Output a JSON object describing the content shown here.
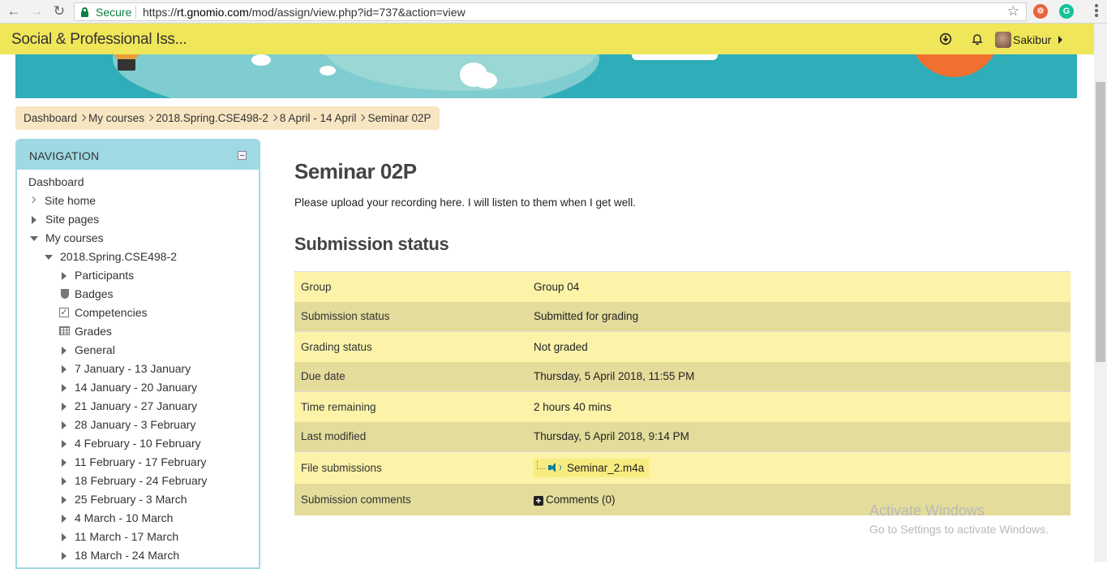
{
  "browser": {
    "secure_label": "Secure",
    "url_scheme": "https://",
    "url_host": "rt.gnomio.com",
    "url_path": "/mod/assign/view.php?id=737&action=view"
  },
  "header": {
    "site_title": "Social & Professional Iss...",
    "user_name": "Sakibur"
  },
  "breadcrumb": [
    "Dashboard",
    "My courses",
    "2018.Spring.CSE498-2",
    "8 April - 14 April",
    "Seminar 02P"
  ],
  "navigation": {
    "title": "NAVIGATION",
    "items": [
      {
        "label": "Dashboard"
      },
      {
        "label": "Site home"
      },
      {
        "label": "Site pages"
      },
      {
        "label": "My courses"
      },
      {
        "label": "2018.Spring.CSE498-2"
      },
      {
        "label": "Participants"
      },
      {
        "label": "Badges"
      },
      {
        "label": "Competencies"
      },
      {
        "label": "Grades"
      },
      {
        "label": "General"
      },
      {
        "label": "7 January - 13 January"
      },
      {
        "label": "14 January - 20 January"
      },
      {
        "label": "21 January - 27 January"
      },
      {
        "label": "28 January - 3 February"
      },
      {
        "label": "4 February - 10 February"
      },
      {
        "label": "11 February - 17 February"
      },
      {
        "label": "18 February - 24 February"
      },
      {
        "label": "25 February - 3 March"
      },
      {
        "label": "4 March - 10 March"
      },
      {
        "label": "11 March - 17 March"
      },
      {
        "label": "18 March - 24 March"
      }
    ]
  },
  "main": {
    "title": "Seminar 02P",
    "intro": "Please upload your recording here. I will listen to them when I get well.",
    "status_heading": "Submission status",
    "rows": [
      {
        "label": "Group",
        "value": "Group 04"
      },
      {
        "label": "Submission status",
        "value": "Submitted for grading"
      },
      {
        "label": "Grading status",
        "value": "Not graded"
      },
      {
        "label": "Due date",
        "value": "Thursday, 5 April 2018, 11:55 PM"
      },
      {
        "label": "Time remaining",
        "value": "2 hours 40 mins"
      },
      {
        "label": "Last modified",
        "value": "Thursday, 5 April 2018, 9:14 PM"
      },
      {
        "label": "File submissions",
        "value": "Seminar_2.m4a"
      },
      {
        "label": "Submission comments",
        "value": "Comments (0)"
      }
    ]
  },
  "watermark": {
    "line1": "Activate Windows",
    "line2": "Go to Settings to activate Windows."
  },
  "colors": {
    "topbar": "#f0e659",
    "nav_header": "#9fd9e3",
    "breadcrumb_bg": "#f8e6c3",
    "row_light": "#fcf3a9",
    "row_dark": "#e4dc9b",
    "banner": "#2fadb8"
  }
}
